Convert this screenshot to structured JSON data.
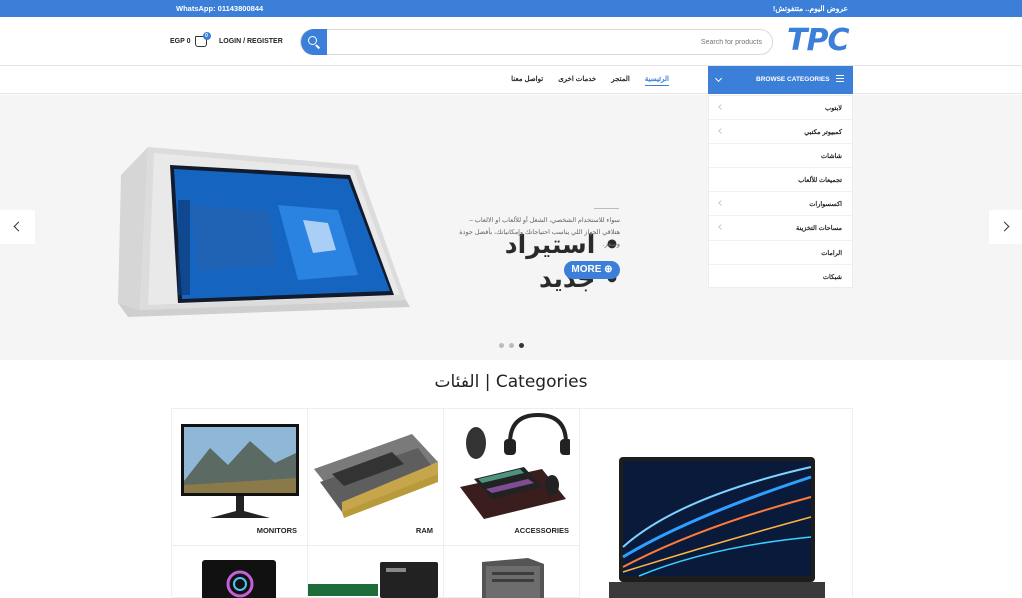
{
  "topbar": {
    "whatsapp": "WhatsApp: 01143800844",
    "promo": "عروض اليوم.. متتفوتش!"
  },
  "header": {
    "cart_total": "EGP 0",
    "cart_count": "0",
    "login": "LOGIN / REGISTER",
    "search_placeholder": "Search for products",
    "logo": "TPC"
  },
  "nav": {
    "browse_label": "BROWSE CATEGORIES",
    "links": [
      "الرئيسية",
      "المتجر",
      "خدمات اخرى",
      "تواصل معنا"
    ]
  },
  "categories_menu": [
    "لابتوب",
    "كمبيوتر مكتبي",
    "شاشات",
    "تجميعات للألعاب",
    "اكسسوارات",
    "مساحات التخزينة",
    "الرامات",
    "شبكات"
  ],
  "hero": {
    "title_line1": "• استيراد",
    "title_line2": "• جديد",
    "description": "سواء للاستخدام الشخصي، الشغل أو للألعاب او الالعاب – هتلاقي الجهاز اللي يناسب احتياجاتك وإمكانياتك، بأفضل جودة وسعر.",
    "button": "MORE ⊕"
  },
  "section_title": "الفئات  |  Categories",
  "grid": {
    "monitors": "MONITORS",
    "ram": "RAM",
    "accessories": "ACCESSORIES"
  },
  "colors": {
    "accent": "#3b7fd9"
  }
}
